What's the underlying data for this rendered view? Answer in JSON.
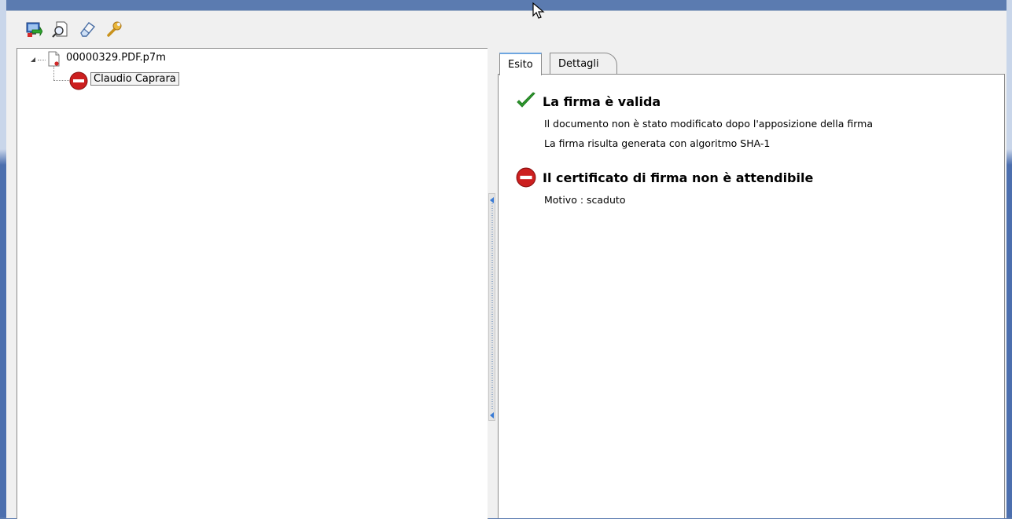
{
  "toolbar": {
    "buttons": [
      {
        "icon": "export-icon"
      },
      {
        "icon": "inspect-document-icon"
      },
      {
        "icon": "eraser-icon"
      },
      {
        "icon": "wrench-icon"
      }
    ]
  },
  "tree": {
    "file": {
      "label": "00000329.PDF.p7m",
      "icon": "document-icon"
    },
    "signer": {
      "label": "Claudio Caprara",
      "icon": "no-entry-icon"
    }
  },
  "tabs": {
    "esito": "Esito",
    "dettagli": "Dettagli"
  },
  "result": {
    "signature": {
      "title": "La firma è valida",
      "icon": "checkmark-icon",
      "lines": [
        "Il documento non è stato modificato dopo l'apposizione della firma",
        "La firma risulta generata con algoritmo SHA-1"
      ]
    },
    "certificate": {
      "title": "Il certificato di firma non è attendibile",
      "icon": "no-entry-icon",
      "lines": [
        "Motivo : scaduto"
      ]
    }
  },
  "colors": {
    "error": "#cc1f1f",
    "success": "#2e9a2e",
    "tab_accent": "#6ea6e0"
  }
}
